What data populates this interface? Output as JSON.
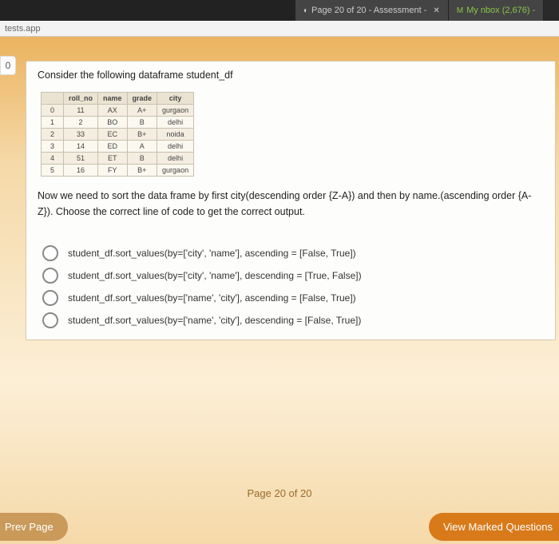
{
  "tabs": [
    {
      "label": "Page 20 of 20 - Assessment -",
      "close": "✕"
    },
    {
      "label": "My  nbox (2,676) -"
    }
  ],
  "addressbar": "tests.app",
  "sidebar_num": "0",
  "question": {
    "title": "Consider the following dataframe student_df",
    "table": {
      "headers": [
        "",
        "roll_no",
        "name",
        "grade",
        "city"
      ],
      "rows": [
        [
          "0",
          "11",
          "AX",
          "A+",
          "gurgaon"
        ],
        [
          "1",
          "2",
          "BO",
          "B",
          "delhi"
        ],
        [
          "2",
          "33",
          "EC",
          "B+",
          "noida"
        ],
        [
          "3",
          "14",
          "ED",
          "A",
          "delhi"
        ],
        [
          "4",
          "51",
          "ET",
          "B",
          "delhi"
        ],
        [
          "5",
          "16",
          "FY",
          "B+",
          "gurgaon"
        ]
      ]
    },
    "body": "Now we need to sort the data frame by first city(descending order {Z-A}) and then by name.(ascending order {A-Z}). Choose the correct line of code to get the correct output.",
    "options": [
      "student_df.sort_values(by=['city', 'name'], ascending = [False, True])",
      "student_df.sort_values(by=['city', 'name'], descending = [True, False])",
      "student_df.sort_values(by=['name', 'city'], ascending = [False, True])",
      "student_df.sort_values(by=['name', 'city'], descending = [False, True])"
    ]
  },
  "pagenum": "Page 20 of 20",
  "buttons": {
    "prev": "Prev Page",
    "marked": "View Marked Questions"
  }
}
